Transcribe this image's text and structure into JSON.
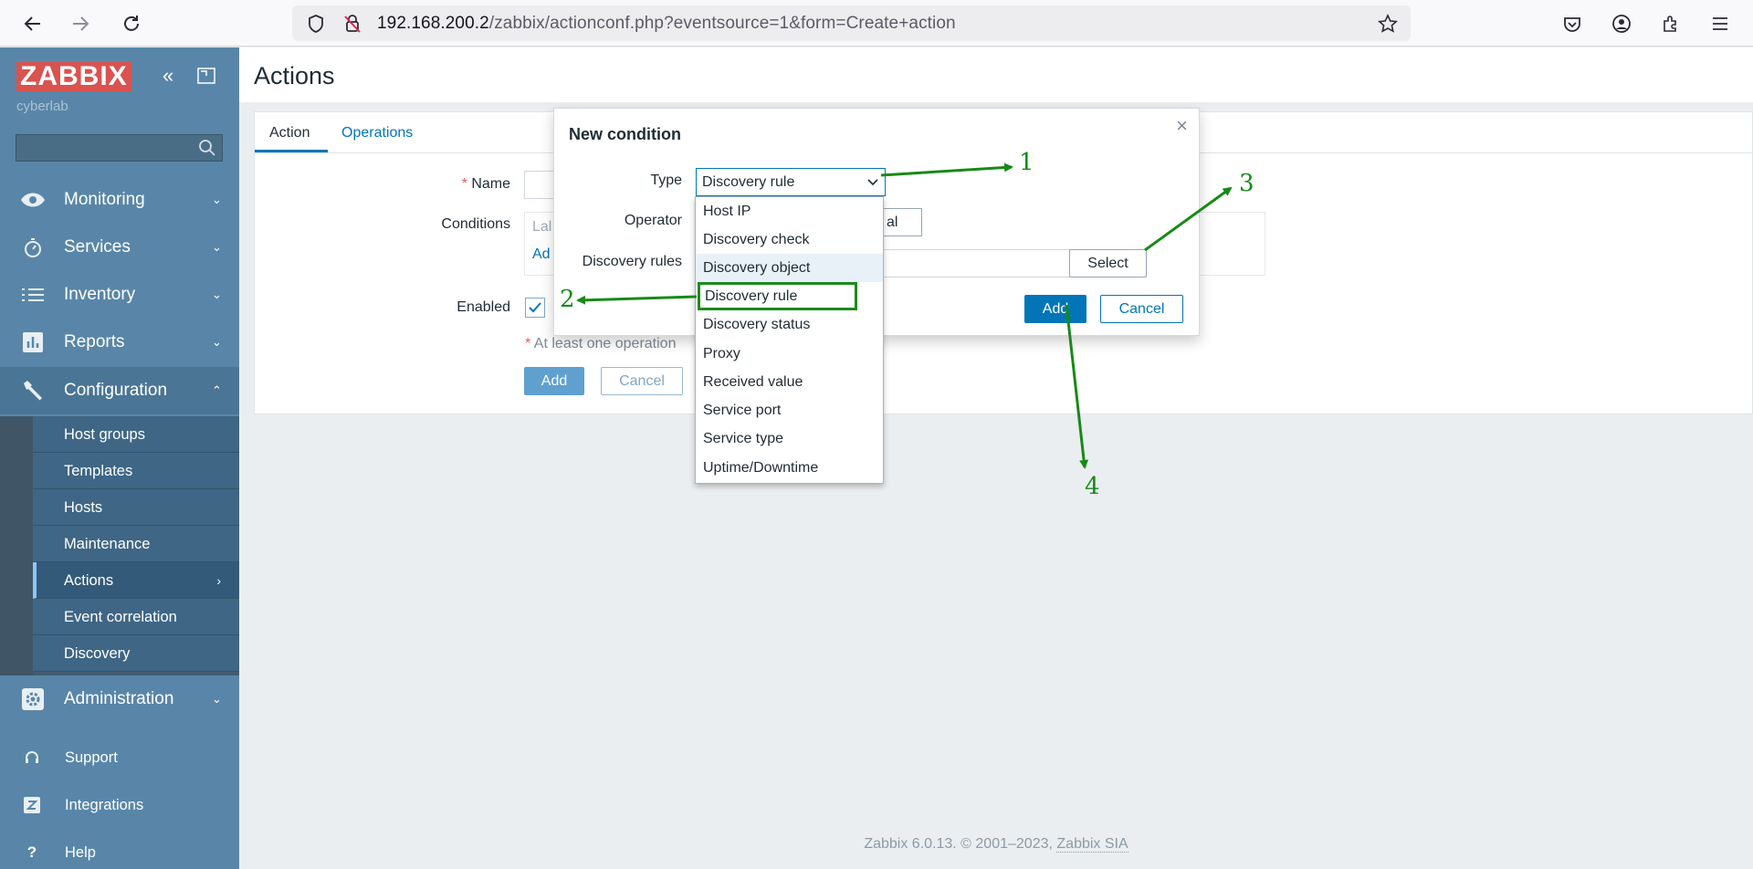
{
  "browser": {
    "url_host": "192.168.200.2",
    "url_path": "/zabbix/actionconf.php?eventsource=1&form=Create+action"
  },
  "sidebar": {
    "logo": "ZABBIX",
    "server_name": "cyberlab",
    "menu": [
      {
        "label": "Monitoring",
        "icon": "eye-icon"
      },
      {
        "label": "Services",
        "icon": "stopwatch-icon"
      },
      {
        "label": "Inventory",
        "icon": "list-icon"
      },
      {
        "label": "Reports",
        "icon": "bar-chart-icon"
      },
      {
        "label": "Configuration",
        "icon": "wrench-icon"
      },
      {
        "label": "Administration",
        "icon": "gear-icon"
      }
    ],
    "configuration_submenu": [
      "Host groups",
      "Templates",
      "Hosts",
      "Maintenance",
      "Actions",
      "Event correlation",
      "Discovery"
    ],
    "bottom": [
      {
        "label": "Support",
        "icon": "headset-icon"
      },
      {
        "label": "Integrations",
        "icon": "z-icon"
      },
      {
        "label": "Help",
        "icon": "question-icon"
      }
    ]
  },
  "main": {
    "page_title": "Actions",
    "tabs": [
      "Action",
      "Operations"
    ],
    "form": {
      "name_label": "Name",
      "conditions_label": "Conditions",
      "conditions_partial_col": "Lal",
      "conditions_partial_add": "Ad",
      "enabled_label": "Enabled",
      "note": "At least one operation",
      "add_button": "Add",
      "cancel_button": "Cancel"
    },
    "footer": {
      "text": "Zabbix 6.0.13. © 2001–2023,",
      "link": "Zabbix SIA"
    }
  },
  "modal": {
    "title": "New condition",
    "type_label": "Type",
    "type_value": "Discovery rule",
    "operator_label": "Operator",
    "operator_partial": "al",
    "rules_label": "Discovery rules",
    "select_button": "Select",
    "add_button": "Add",
    "cancel_button": "Cancel",
    "dropdown_options": [
      "Host IP",
      "Discovery check",
      "Discovery object",
      "Discovery rule",
      "Discovery status",
      "Proxy",
      "Received value",
      "Service port",
      "Service type",
      "Uptime/Downtime"
    ]
  },
  "annotations": [
    "1",
    "2",
    "3",
    "4"
  ],
  "colors": {
    "annotation": "#178a17",
    "accent": "#0275b8",
    "sidebar": "#5986a8"
  }
}
